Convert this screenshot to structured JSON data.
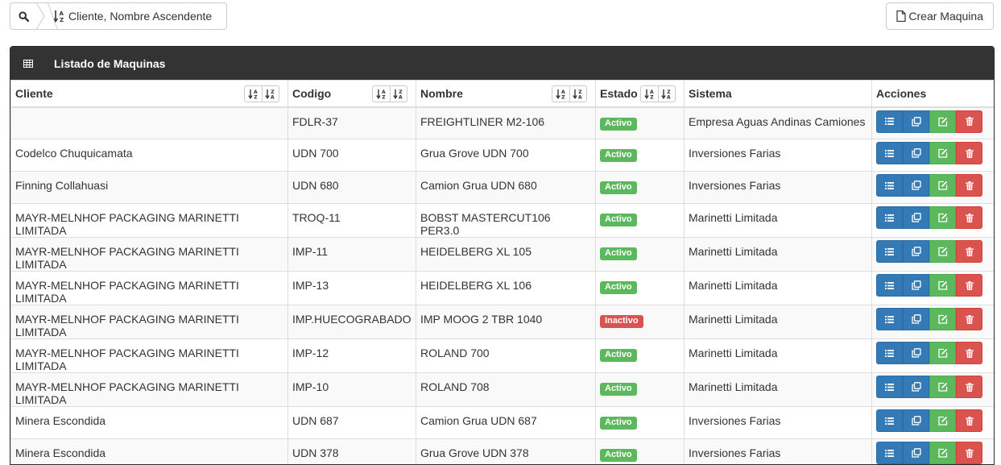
{
  "toolbar": {
    "sort_label": "Cliente, Nombre Ascendente",
    "create_label": "Crear Maquina"
  },
  "panel": {
    "title": "Listado de Maquinas"
  },
  "table": {
    "columns": [
      "Cliente",
      "Codigo",
      "Nombre",
      "Estado",
      "Sistema",
      "Acciones"
    ],
    "rows": [
      {
        "cliente": "",
        "codigo": "FDLR-37",
        "nombre": "FREIGHTLINER M2-106",
        "estado": "Activo",
        "sistema": "Empresa Aguas Andinas Camiones"
      },
      {
        "cliente": "Codelco Chuquicamata",
        "codigo": "UDN 700",
        "nombre": "Grua Grove UDN 700",
        "estado": "Activo",
        "sistema": "Inversiones Farias"
      },
      {
        "cliente": "Finning Collahuasi",
        "codigo": "UDN 680",
        "nombre": "Camion Grua UDN 680",
        "estado": "Activo",
        "sistema": "Inversiones Farias"
      },
      {
        "cliente": "MAYR-MELNHOF PACKAGING MARINETTI LIMITADA",
        "codigo": "TROQ-11",
        "nombre": "BOBST MASTERCUT106 PER3.0",
        "estado": "Activo",
        "sistema": "Marinetti Limitada"
      },
      {
        "cliente": "MAYR-MELNHOF PACKAGING MARINETTI LIMITADA",
        "codigo": "IMP-11",
        "nombre": "HEIDELBERG XL 105",
        "estado": "Activo",
        "sistema": "Marinetti Limitada"
      },
      {
        "cliente": "MAYR-MELNHOF PACKAGING MARINETTI LIMITADA",
        "codigo": "IMP-13",
        "nombre": "HEIDELBERG XL 106",
        "estado": "Activo",
        "sistema": "Marinetti Limitada"
      },
      {
        "cliente": "MAYR-MELNHOF PACKAGING MARINETTI LIMITADA",
        "codigo": "IMP.HUECOGRABADO",
        "nombre": "IMP MOOG 2 TBR 1040",
        "estado": "Inactivo",
        "sistema": "Marinetti Limitada"
      },
      {
        "cliente": "MAYR-MELNHOF PACKAGING MARINETTI LIMITADA",
        "codigo": "IMP-12",
        "nombre": "ROLAND 700",
        "estado": "Activo",
        "sistema": "Marinetti Limitada"
      },
      {
        "cliente": "MAYR-MELNHOF PACKAGING MARINETTI LIMITADA",
        "codigo": "IMP-10",
        "nombre": "ROLAND 708",
        "estado": "Activo",
        "sistema": "Marinetti Limitada"
      },
      {
        "cliente": "Minera Escondida",
        "codigo": "UDN 687",
        "nombre": "Camion Grua UDN 687",
        "estado": "Activo",
        "sistema": "Inversiones Farias"
      },
      {
        "cliente": "Minera Escondida",
        "codigo": "UDN 378",
        "nombre": "Grua Grove UDN 378",
        "estado": "Activo",
        "sistema": "Inversiones Farias"
      }
    ]
  },
  "colors": {
    "header_bg": "#333333",
    "active": "#5cb85c",
    "inactive": "#d9534f",
    "primary": "#337ab7",
    "success": "#5cb85c",
    "danger": "#d9534f"
  },
  "icons": {
    "search": "search-icon",
    "sort": "sort-alpha-asc-icon",
    "file": "file-icon",
    "table": "table-icon",
    "list": "list-icon",
    "copy": "copy-icon",
    "edit": "edit-icon",
    "delete": "trash-icon"
  }
}
